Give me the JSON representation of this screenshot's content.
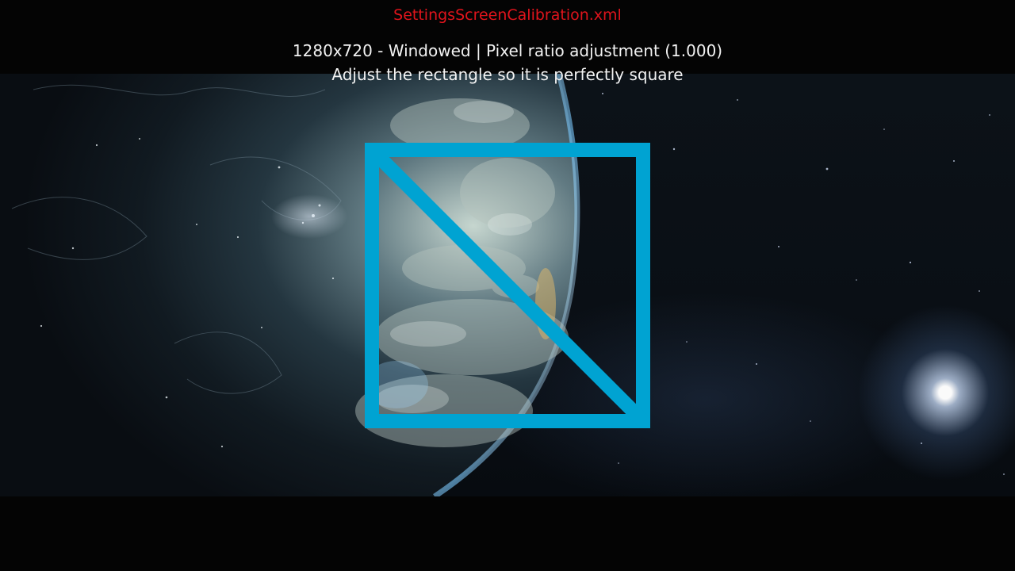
{
  "screen": {
    "title": "SettingsScreenCalibration.xml",
    "mode_line": "1280x720 - Windowed | Pixel ratio adjustment (1.000)",
    "instruction": "Adjust the rectangle so it is perfectly square"
  },
  "colors": {
    "title": "#e0141c",
    "text": "#f2f2f2",
    "calibration_shape": "#00a3d2",
    "bars": "#040404"
  },
  "icons": {
    "calibration_shape": "square-with-diagonal-icon"
  }
}
